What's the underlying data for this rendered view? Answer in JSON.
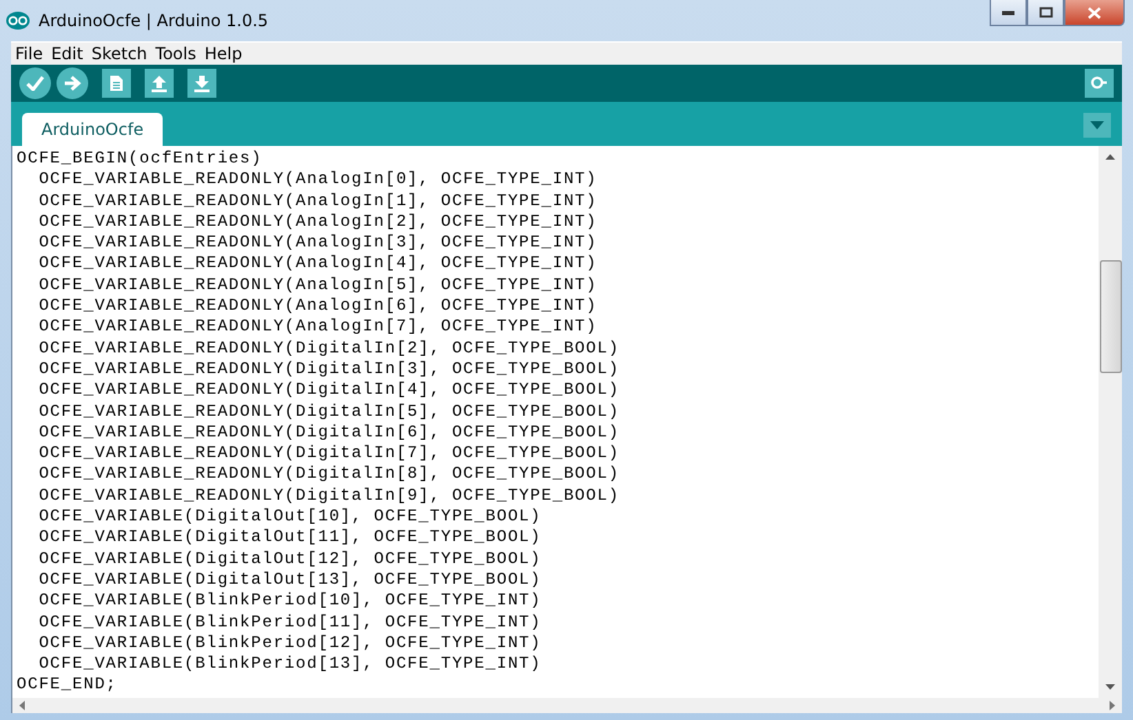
{
  "window": {
    "title": "ArduinoOcfe | Arduino 1.0.5"
  },
  "menu": [
    "File",
    "Edit",
    "Sketch",
    "Tools",
    "Help"
  ],
  "toolbar": [
    {
      "kind": "round"
    },
    {
      "kind": "round"
    },
    {
      "kind": "square"
    },
    {
      "kind": "square"
    },
    {
      "kind": "square"
    }
  ],
  "tabs": [
    {
      "label": "ArduinoOcfe",
      "selected": true
    }
  ],
  "code": [
    "OCFE_BEGIN(ocfEntries)",
    "  OCFE_VARIABLE_READONLY(AnalogIn[0], OCFE_TYPE_INT)",
    "  OCFE_VARIABLE_READONLY(AnalogIn[1], OCFE_TYPE_INT)",
    "  OCFE_VARIABLE_READONLY(AnalogIn[2], OCFE_TYPE_INT)",
    "  OCFE_VARIABLE_READONLY(AnalogIn[3], OCFE_TYPE_INT)",
    "  OCFE_VARIABLE_READONLY(AnalogIn[4], OCFE_TYPE_INT)",
    "  OCFE_VARIABLE_READONLY(AnalogIn[5], OCFE_TYPE_INT)",
    "  OCFE_VARIABLE_READONLY(AnalogIn[6], OCFE_TYPE_INT)",
    "  OCFE_VARIABLE_READONLY(AnalogIn[7], OCFE_TYPE_INT)",
    "  OCFE_VARIABLE_READONLY(DigitalIn[2], OCFE_TYPE_BOOL)",
    "  OCFE_VARIABLE_READONLY(DigitalIn[3], OCFE_TYPE_BOOL)",
    "  OCFE_VARIABLE_READONLY(DigitalIn[4], OCFE_TYPE_BOOL)",
    "  OCFE_VARIABLE_READONLY(DigitalIn[5], OCFE_TYPE_BOOL)",
    "  OCFE_VARIABLE_READONLY(DigitalIn[6], OCFE_TYPE_BOOL)",
    "  OCFE_VARIABLE_READONLY(DigitalIn[7], OCFE_TYPE_BOOL)",
    "  OCFE_VARIABLE_READONLY(DigitalIn[8], OCFE_TYPE_BOOL)",
    "  OCFE_VARIABLE_READONLY(DigitalIn[9], OCFE_TYPE_BOOL)",
    "  OCFE_VARIABLE(DigitalOut[10], OCFE_TYPE_BOOL)",
    "  OCFE_VARIABLE(DigitalOut[11], OCFE_TYPE_BOOL)",
    "  OCFE_VARIABLE(DigitalOut[12], OCFE_TYPE_BOOL)",
    "  OCFE_VARIABLE(DigitalOut[13], OCFE_TYPE_BOOL)",
    "  OCFE_VARIABLE(BlinkPeriod[10], OCFE_TYPE_INT)",
    "  OCFE_VARIABLE(BlinkPeriod[11], OCFE_TYPE_INT)",
    "  OCFE_VARIABLE(BlinkPeriod[12], OCFE_TYPE_INT)",
    "  OCFE_VARIABLE(BlinkPeriod[13], OCFE_TYPE_INT)",
    "OCFE_END;"
  ]
}
